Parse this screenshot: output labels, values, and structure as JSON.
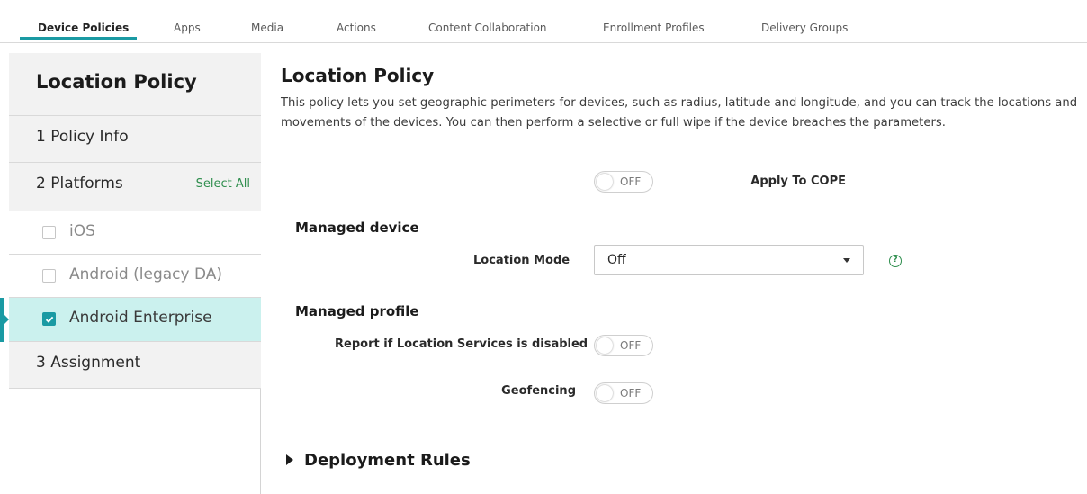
{
  "tabs": [
    {
      "label": "Device Policies",
      "active": true
    },
    {
      "label": "Apps",
      "active": false
    },
    {
      "label": "Media",
      "active": false
    },
    {
      "label": "Actions",
      "active": false
    },
    {
      "label": "Content Collaboration",
      "active": false
    },
    {
      "label": "Enrollment Profiles",
      "active": false
    },
    {
      "label": "Delivery Groups",
      "active": false
    }
  ],
  "sidebar": {
    "title": "Location Policy",
    "steps": {
      "policy_info": "1  Policy Info",
      "platforms": "2  Platforms",
      "select_all": "Select All",
      "assignment": "3  Assignment"
    },
    "platforms": [
      {
        "label": "iOS",
        "checked": false
      },
      {
        "label": "Android (legacy DA)",
        "checked": false
      },
      {
        "label": "Android Enterprise",
        "checked": true
      }
    ]
  },
  "main": {
    "title": "Location Policy",
    "description": "This policy lets you set geographic perimeters for devices, such as radius, latitude and longitude, and you can track the locations and movements of the devices. You can then perform a selective or full wipe if the device breaches the parameters.",
    "apply_to_cope": {
      "label": "Apply To COPE",
      "state": "OFF"
    },
    "managed_device": {
      "heading": "Managed device",
      "location_mode": {
        "label": "Location Mode",
        "value": "Off",
        "help": "?"
      }
    },
    "managed_profile": {
      "heading": "Managed profile",
      "report_disabled": {
        "label": "Report if Location Services is disabled",
        "state": "OFF"
      },
      "geofencing": {
        "label": "Geofencing",
        "state": "OFF"
      }
    },
    "deployment_rules": "Deployment Rules"
  },
  "colors": {
    "accent": "#1a9aa3",
    "link_green": "#2f8e4e",
    "selected_bg": "#cbf1ee",
    "sidebar_bg": "#f2f2f2"
  }
}
